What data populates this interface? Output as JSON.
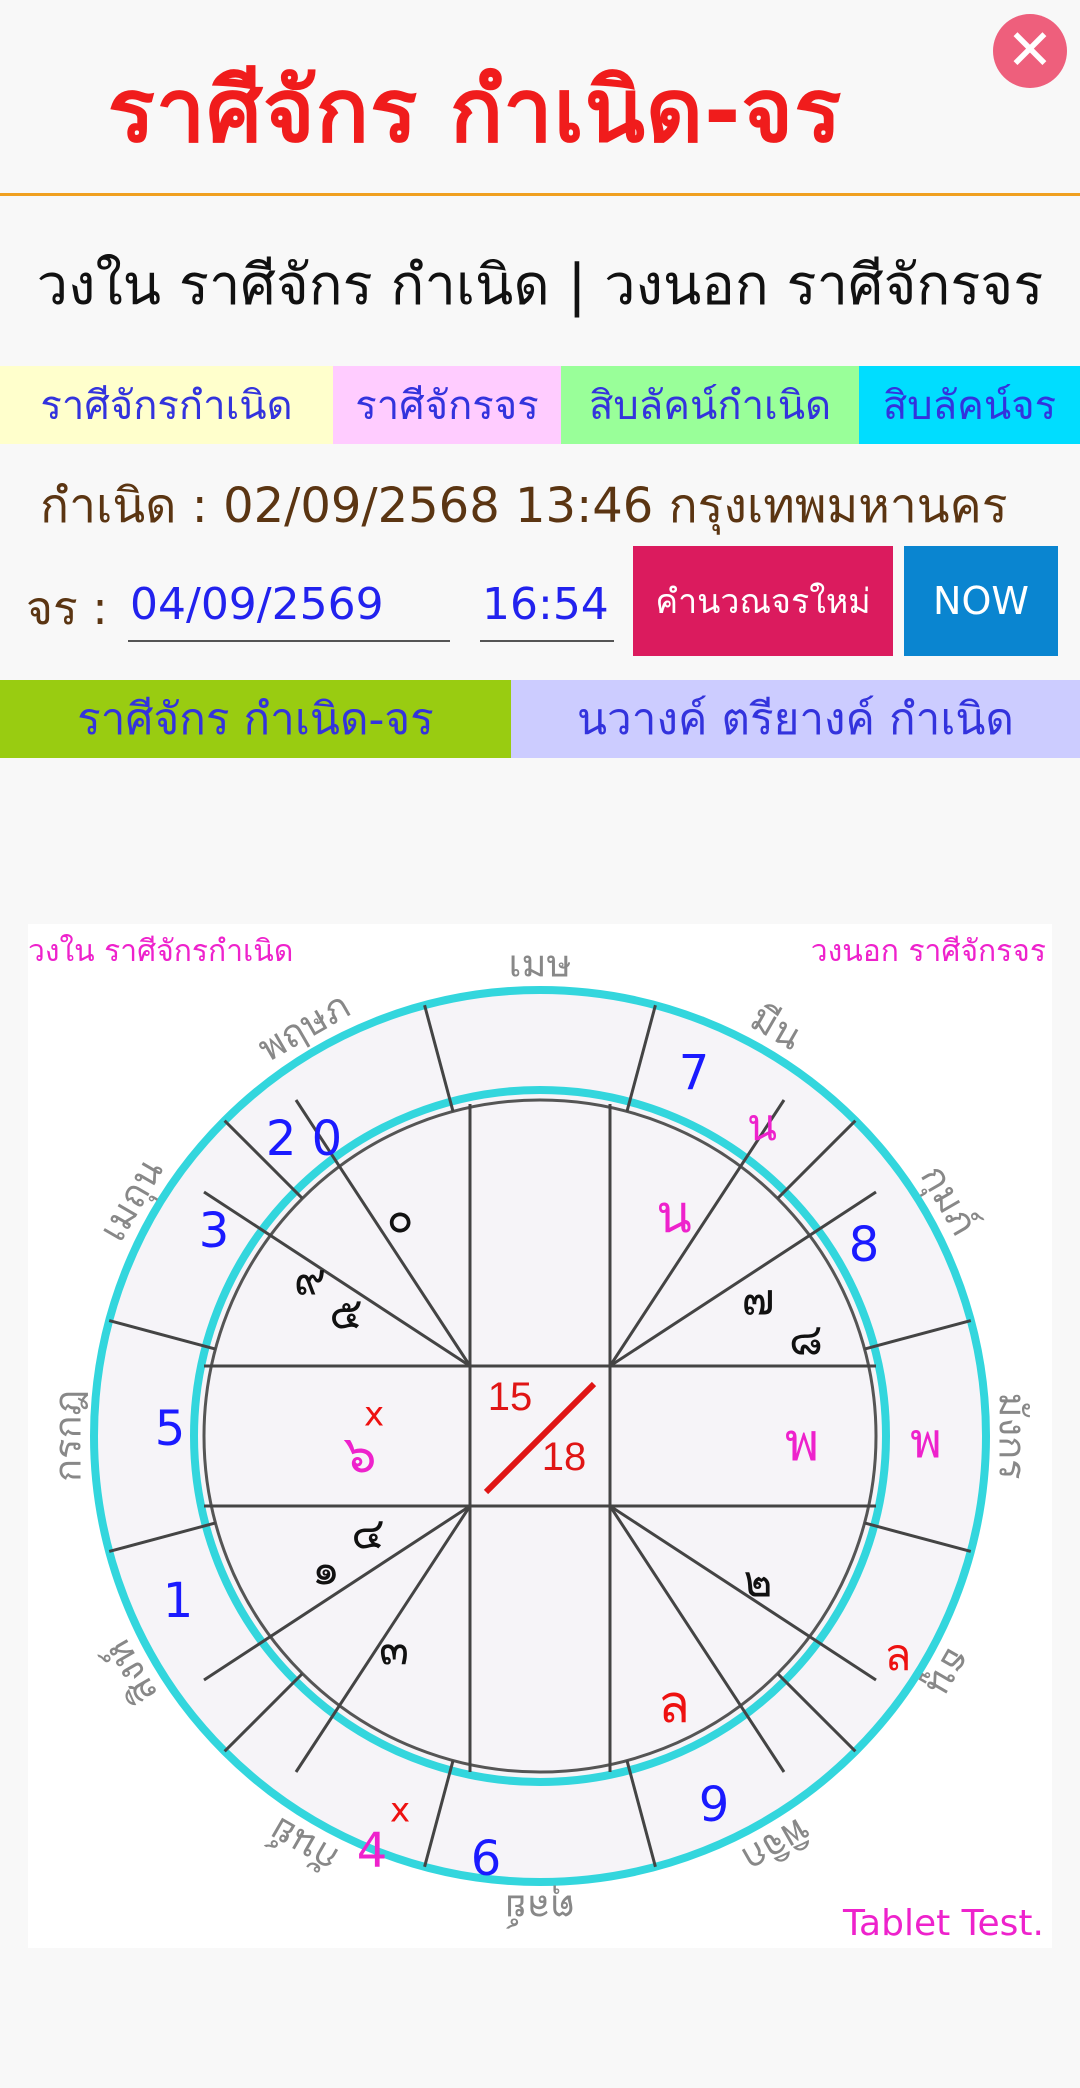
{
  "header": {
    "title": "ราศีจักร กำเนิด-จร",
    "close_icon": "close-icon"
  },
  "subtitle": "วงใน ราศีจักร กำเนิด | วงนอก ราศีจักรจร",
  "tabs": [
    {
      "label": "ราศีจักรกำเนิด",
      "color": "#ffffcc"
    },
    {
      "label": "ราศีจักรจร",
      "color": "#ffccff"
    },
    {
      "label": "สิบลัคน์กำเนิด",
      "color": "#99ff99"
    },
    {
      "label": "สิบลัคน์จร",
      "color": "#00ddff"
    }
  ],
  "birth_line": "กำเนิด : 02/09/2568 13:46 กรุงเทพมหานคร",
  "transit": {
    "label": "จร :",
    "date_value": "04/09/2569",
    "time_value": "16:54",
    "calc_label": "คำนวณจรใหม่",
    "now_label": "NOW"
  },
  "view_tabs": [
    {
      "label": "ราศีจักร กำเนิด-จร",
      "color": "#99cc11"
    },
    {
      "label": "นวางค์ ตรียางค์ กำเนิด",
      "color": "#ccccff"
    }
  ],
  "chart": {
    "inner_label": "วงใน ราศีจักรกำเนิด",
    "outer_label": "วงนอก ราศีจักรจร",
    "footer_label": "Tablet  Test.",
    "signs": [
      "เมษ",
      "มีน",
      "กุมภ์",
      "มังกร",
      "ธนู",
      "พิจิก",
      "ตุลย์",
      "กันย์",
      "สิงห์",
      "กรกฎ",
      "เมถุน",
      "พฤษภ"
    ],
    "center_top": "15",
    "center_bottom": "18",
    "outer_marks": [
      {
        "text": "7",
        "color": "#1a1aff"
      },
      {
        "text": "น",
        "color": "#ee22cc"
      },
      {
        "text": "8",
        "color": "#1a1aff"
      },
      {
        "text": "พ",
        "color": "#ee22cc"
      },
      {
        "text": "ล",
        "color": "#ee1111"
      },
      {
        "text": "9",
        "color": "#1a1aff"
      },
      {
        "text": "6",
        "color": "#1a1aff"
      },
      {
        "text": "4",
        "color": "#ee22cc"
      },
      {
        "text": "x",
        "color": "#ee1111"
      },
      {
        "text": "1",
        "color": "#1a1aff"
      },
      {
        "text": "5",
        "color": "#1a1aff"
      },
      {
        "text": "3",
        "color": "#1a1aff"
      },
      {
        "text": "2 0",
        "color": "#1a1aff"
      }
    ],
    "inner_marks": [
      {
        "text": "น",
        "color": "#ee22cc"
      },
      {
        "text": "๗",
        "color": "#111111"
      },
      {
        "text": "๘",
        "color": "#111111"
      },
      {
        "text": "พ",
        "color": "#ee22cc"
      },
      {
        "text": "๒",
        "color": "#111111"
      },
      {
        "text": "ล",
        "color": "#ee1111"
      },
      {
        "text": "๑",
        "color": "#111111"
      },
      {
        "text": "๔",
        "color": "#111111"
      },
      {
        "text": "๓",
        "color": "#111111"
      },
      {
        "text": "๖",
        "color": "#ee22cc"
      },
      {
        "text": "x",
        "color": "#ee1111"
      },
      {
        "text": "๙",
        "color": "#111111"
      },
      {
        "text": "๕",
        "color": "#111111"
      },
      {
        "text": "๐",
        "color": "#111111"
      }
    ]
  }
}
